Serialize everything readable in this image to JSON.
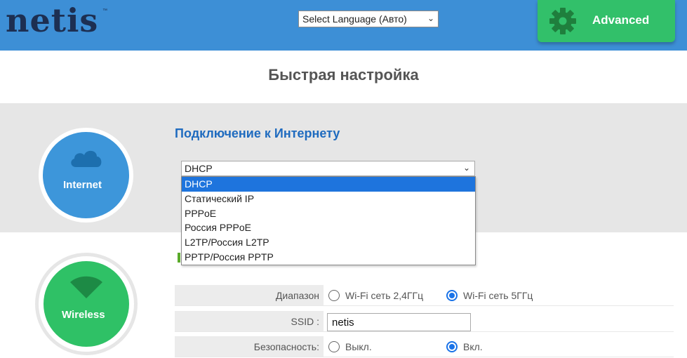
{
  "header": {
    "logo": "netis",
    "logo_tm": "™",
    "language_select": "Select Language (Авто)",
    "advanced_label": "Advanced"
  },
  "page_title": "Быстрая настройка",
  "internet": {
    "circle_label": "Internet",
    "section_title": "Подключение к Интернету",
    "connection_type": "DHCP",
    "options": [
      "DHCP",
      "Статический IP",
      "PPPoE",
      "Россия PPPoE",
      "L2TP/Россия L2TP",
      "PPTP/Россия PPTP"
    ]
  },
  "wireless": {
    "circle_label": "Wireless",
    "band_label": "Диапазон",
    "band_24": "Wi-Fi сеть 2,4ГГц",
    "band_5": "Wi-Fi сеть 5ГГц",
    "band_selected": "5GHz",
    "ssid_label": "SSID :",
    "ssid_value": "netis",
    "security_label": "Безопасность:",
    "security_off": "Выкл.",
    "security_on": "Вкл.",
    "security_selected": "on"
  },
  "colors": {
    "header_bg": "#3d8fd6",
    "advanced_bg": "#32c06a",
    "internet_circle": "#3d96da",
    "wireless_circle": "#2fc166",
    "accent_title": "#1f6bbf",
    "selected_option": "#1e74dd"
  }
}
